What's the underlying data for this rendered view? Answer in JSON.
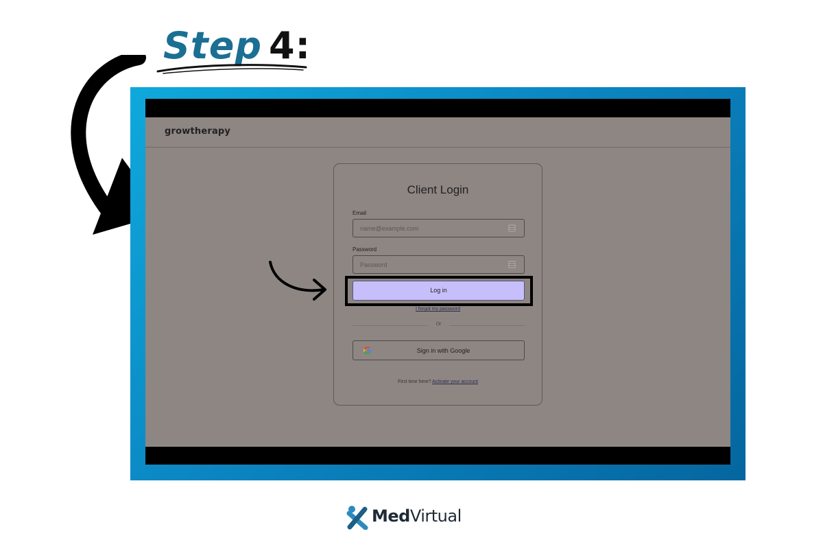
{
  "heading": {
    "step_word": "Step",
    "step_number": "4:"
  },
  "app": {
    "brand": "growtherapy",
    "login_card": {
      "title": "Client Login",
      "email_label": "Email",
      "email_placeholder": "name@example.com",
      "password_label": "Password",
      "password_placeholder": "Password",
      "login_button": "Log in",
      "forgot_link": "I forgot my password",
      "divider_text": "Or",
      "google_button": "Sign in with Google",
      "first_time_text": "First time here?",
      "activate_link": "Activate your account"
    }
  },
  "footer_logo": {
    "bold": "Med",
    "regular": "Virtual"
  },
  "colors": {
    "accent_blue": "#1a6f93",
    "frame_gradient_start": "#0fa9dc",
    "frame_gradient_end": "#05669f",
    "login_button": "#c6bffb",
    "screen_overlay": "#8d8683"
  },
  "icons": [
    "big-curved-arrow-icon",
    "small-curved-arrow-icon",
    "keyboard-icon",
    "google-g-icon",
    "medvirtual-logo-icon"
  ]
}
